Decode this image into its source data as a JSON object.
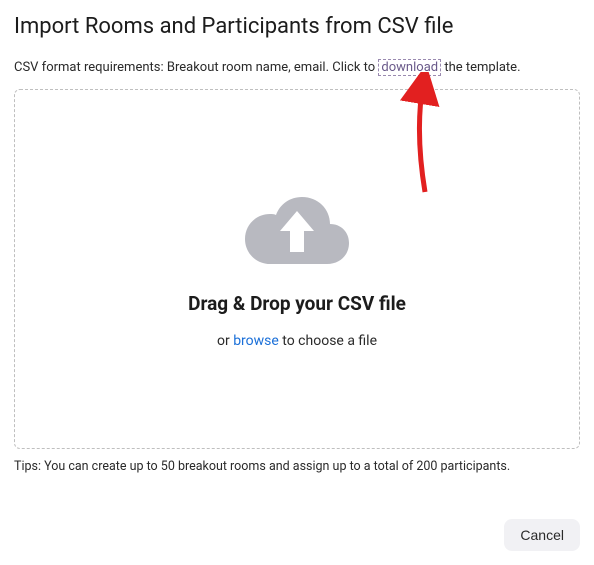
{
  "title": "Import Rooms and Participants from CSV file",
  "description": {
    "prefix": "CSV format requirements: Breakout room name, email. Click to ",
    "download_label": "download",
    "suffix": " the template."
  },
  "dropzone": {
    "heading": "Drag & Drop your CSV file",
    "sub_prefix": "or ",
    "browse_label": "browse",
    "sub_suffix": " to choose a file"
  },
  "tips": "Tips: You can create up to 50 breakout rooms and assign up to a total of 200 participants.",
  "buttons": {
    "cancel": "Cancel"
  }
}
